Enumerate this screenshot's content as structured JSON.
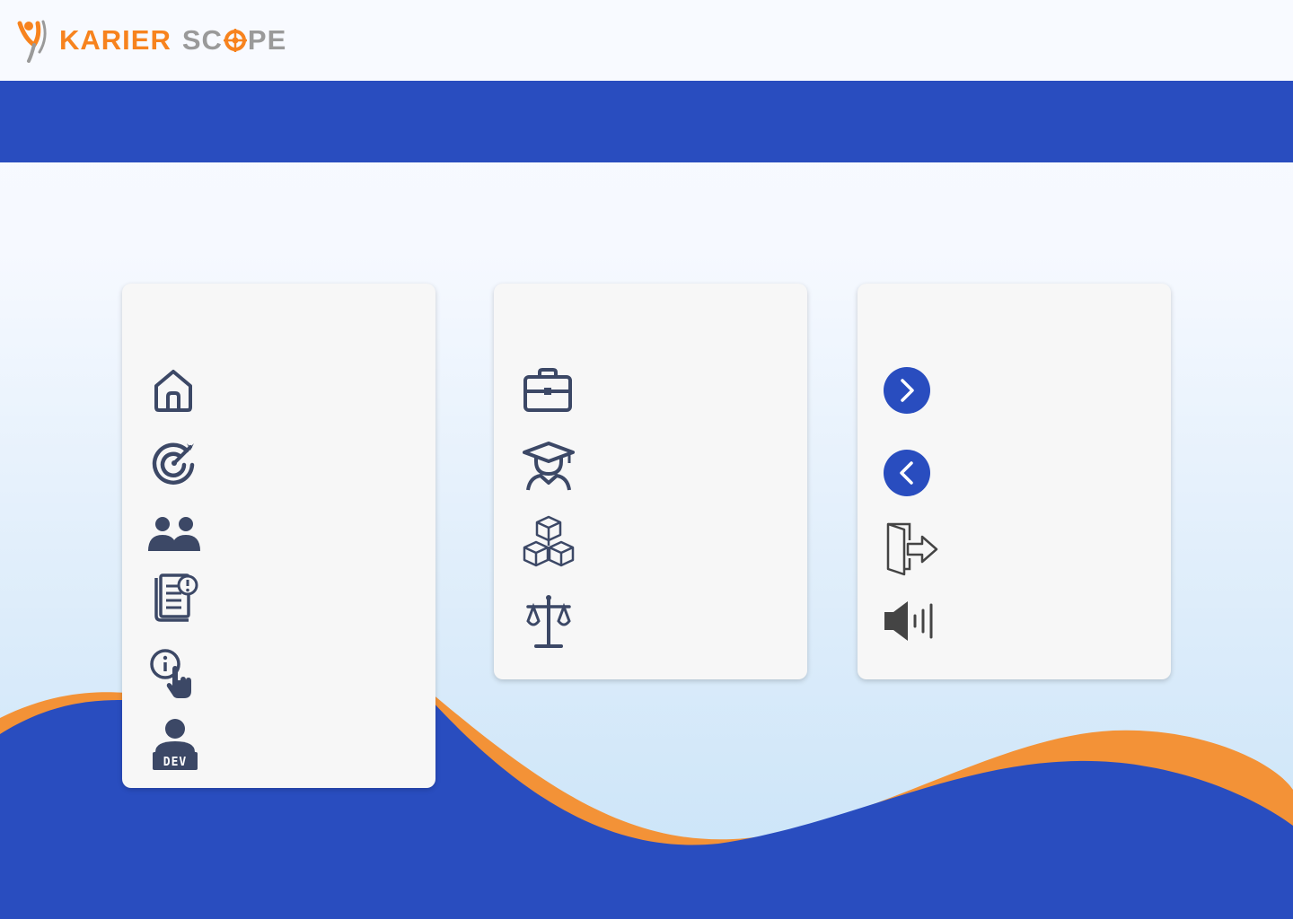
{
  "brand": {
    "name_primary": "KARIER",
    "name_secondary_start": "SC",
    "name_secondary_end": "PE",
    "primary_color": "#f7831e",
    "secondary_color": "#9a9a9a",
    "accent_blue": "#294dbf",
    "accent_orange": "#f39237"
  },
  "cards": {
    "left": {
      "icons": [
        "home-icon",
        "target-goal-icon",
        "users-group-icon",
        "guide-book-icon",
        "info-touch-icon",
        "developer-icon"
      ],
      "dev_badge_text": "DEV"
    },
    "middle": {
      "icons": [
        "briefcase-icon",
        "graduate-icon",
        "cubes-icon",
        "balance-scale-icon"
      ]
    },
    "right": {
      "icons": [
        "next-arrow-icon",
        "back-arrow-icon",
        "exit-door-icon",
        "volume-icon"
      ]
    }
  },
  "icon_color": "#3c4866"
}
